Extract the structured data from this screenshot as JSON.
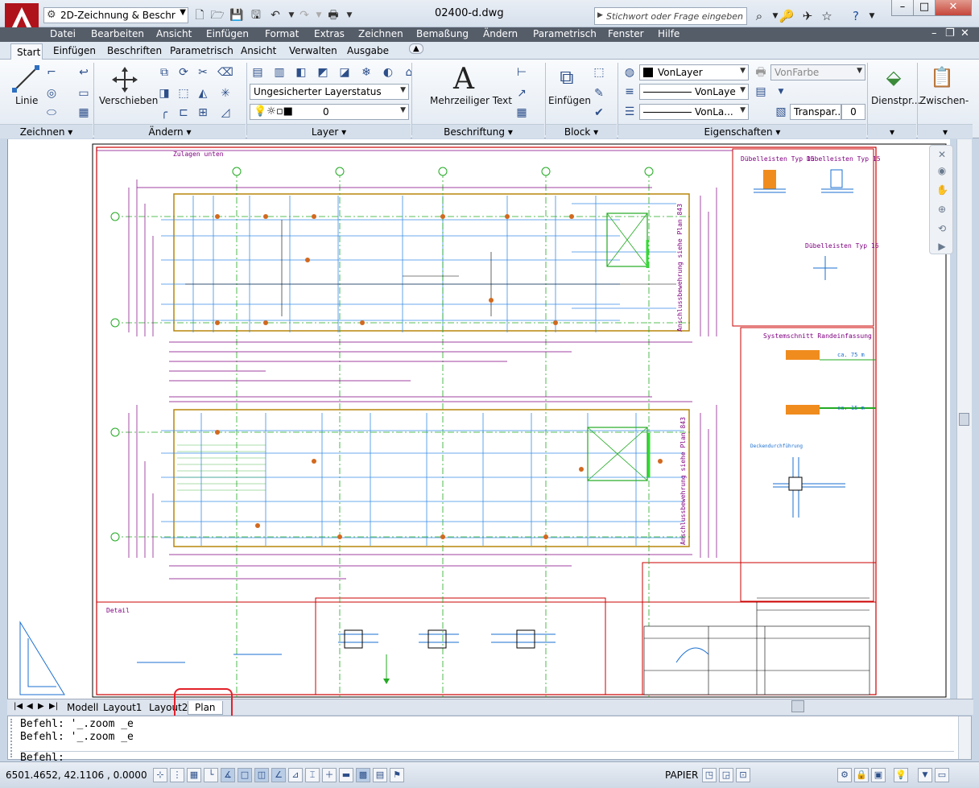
{
  "window": {
    "workspace": "2D-Zeichnung & Beschr",
    "document_title": "02400-d.dwg",
    "help_search_placeholder": "Stichwort oder Frage eingeben"
  },
  "menu": [
    "Datei",
    "Bearbeiten",
    "Ansicht",
    "Einfügen",
    "Format",
    "Extras",
    "Zeichnen",
    "Bemaßung",
    "Ändern",
    "Parametrisch",
    "Fenster",
    "Hilfe"
  ],
  "ribbon_tabs": [
    "Start",
    "Einfügen",
    "Beschriften",
    "Parametrisch",
    "Ansicht",
    "Verwalten",
    "Ausgabe"
  ],
  "ribbon": {
    "draw": {
      "line_label": "Linie",
      "panel_title": "Zeichnen"
    },
    "modify": {
      "move_label": "Verschieben",
      "panel_title": "Ändern"
    },
    "layer": {
      "layer_state": "Ungesicherter Layerstatus",
      "current_layer": "0",
      "panel_title": "Layer"
    },
    "annotation": {
      "mtext_label": "Mehrzeiliger Text",
      "panel_title": "Beschriftung"
    },
    "block": {
      "insert_label": "Einfügen",
      "panel_title": "Block"
    },
    "properties": {
      "color": "VonLayer",
      "linetype": "VonLaye",
      "lineweight": "VonLa...",
      "plotstyle": "VonFarbe",
      "transparency_label": "Transpar...",
      "transparency_value": "0",
      "panel_title": "Eigenschaften"
    },
    "utilities_label": "Dienstpr...",
    "clipboard_label": "Zwischen-"
  },
  "drawing": {
    "title_top": "Zulagen unten",
    "legend_1": "Dübelleisten Typ 15",
    "legend_2": "Dübelleisten Typ 15",
    "legend_3": "Dübelleisten Typ 16",
    "section_title": "Systemschnitt Randeinfassung",
    "vertical_text_1": "Anschlussbewehrung siehe Plan 843",
    "vertical_text_2": "Anschlussbewehrung siehe Plan 843",
    "detail_title": "Detail",
    "drain_label": "Deckendurchführung",
    "length_1": "ca. 75 m",
    "length_2": "ca. 15 m"
  },
  "layout_tabs": [
    "Modell",
    "Layout1",
    "Layout2",
    "Plan"
  ],
  "command_history": [
    "Befehl: '_.zoom _e",
    "Befehl: '_.zoom _e"
  ],
  "command_prompt": "Befehl:",
  "status": {
    "coordinates": "6501.4652, 42.1106 , 0.0000",
    "space": "PAPIER"
  }
}
